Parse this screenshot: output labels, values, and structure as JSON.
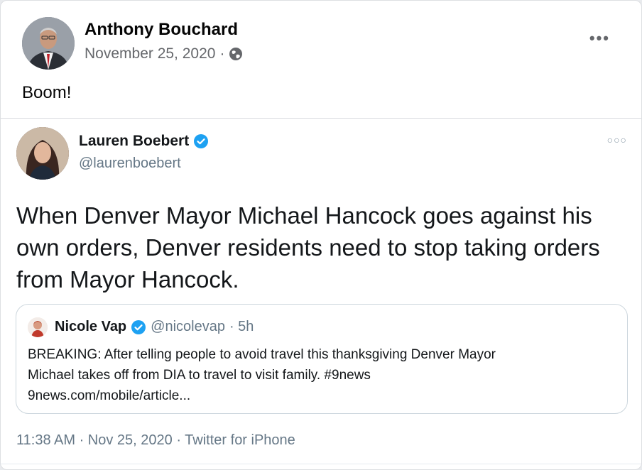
{
  "facebook_post": {
    "author": "Anthony Bouchard",
    "date": "November 25, 2020",
    "separator": "·",
    "privacy_icon": "globe-icon",
    "more_icon": "more-options-icon",
    "caption": "Boom!"
  },
  "tweet": {
    "author": "Lauren Boebert",
    "handle": "@laurenboebert",
    "verified": true,
    "text": "When Denver Mayor Michael Hancock goes against his own orders, Denver residents need to stop taking orders from Mayor Hancock.",
    "footer": "11:38 AM · Nov 25, 2020 · Twitter for iPhone",
    "quoted": {
      "author": "Nicole Vap",
      "handle": "@nicolevap",
      "time": "· 5h",
      "line1": "BREAKING: After telling people to avoid travel this thanksgiving Denver Mayor",
      "line2": "Michael takes off from DIA to travel to visit family. #9news",
      "line3": "9news.com/mobile/article..."
    }
  },
  "colors": {
    "verified": "#1da1f2",
    "fb_secondary_text": "#65676b",
    "tw_secondary_text": "#657786"
  }
}
